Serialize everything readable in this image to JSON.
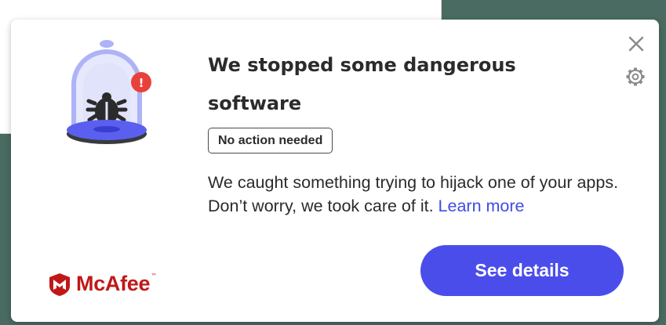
{
  "notification": {
    "title": "We stopped some dangerous software",
    "badge": "No action needed",
    "message": "We caught something trying to hijack one of your apps. Don’t worry, we took care of it.",
    "learn_more": "Learn more",
    "details_button": "See details",
    "alert_mark": "!"
  },
  "brand": {
    "name": "McAfee",
    "trademark": "™"
  },
  "icons": {
    "close": "close-icon",
    "settings": "gear-icon",
    "illustration": "bug-in-jar-icon",
    "alert": "alert-badge-icon",
    "logo": "mcafee-shield-icon"
  },
  "colors": {
    "accent": "#4b4deb",
    "link": "#3e4ce6",
    "brand_red": "#c01818",
    "alert_red": "#e8413a",
    "dome_lavender": "#aeb3f7",
    "background": "#4a6b61"
  }
}
